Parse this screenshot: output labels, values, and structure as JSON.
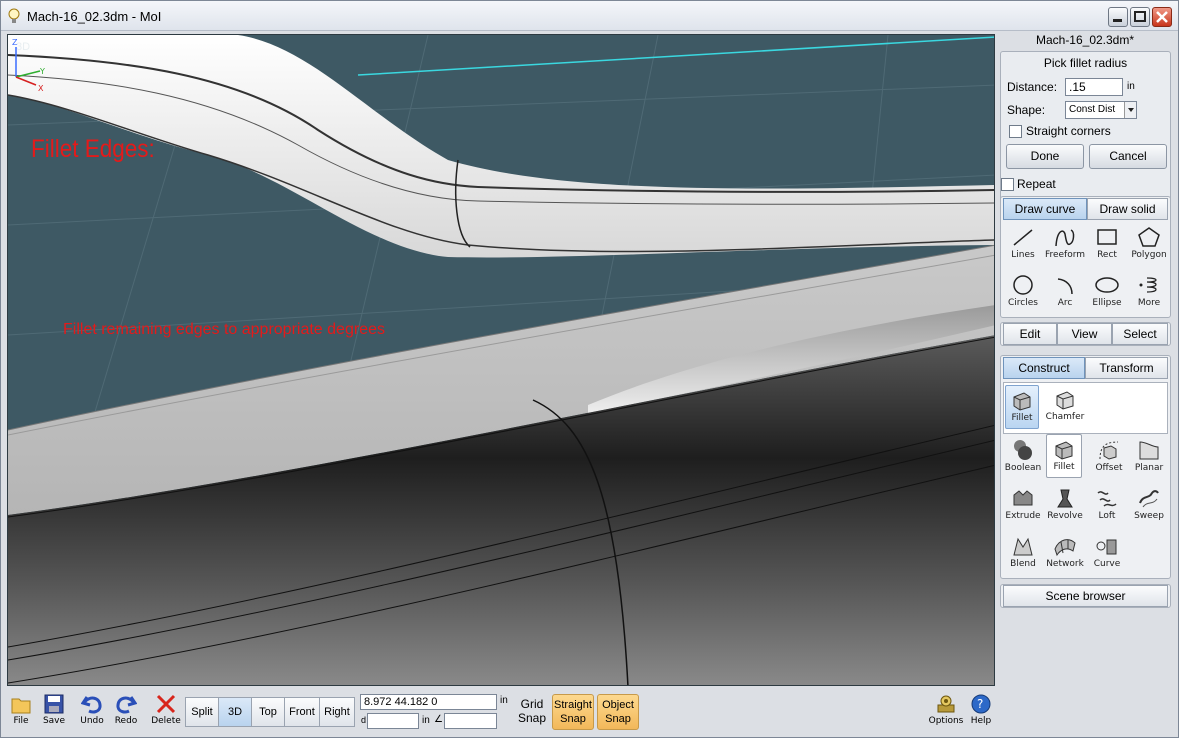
{
  "window": {
    "title": "Mach-16_02.3dm - MoI"
  },
  "viewport": {
    "label": "3D",
    "annotation_title": "Fillet Edges:",
    "annotation_text": "Fillet remaining edges to appropriate degrees",
    "axes": {
      "z": "Z",
      "y": "Y",
      "x": "X"
    }
  },
  "panel": {
    "file_name": "Mach-16_02.3dm*",
    "prompt": "Pick fillet radius",
    "distance_label": "Distance:",
    "distance_value": ".15",
    "distance_unit": "in",
    "shape_label": "Shape:",
    "shape_value": "Const Dist",
    "straight_corners": "Straight corners",
    "done": "Done",
    "cancel": "Cancel",
    "repeat": "Repeat",
    "draw_tabs": [
      "Draw curve",
      "Draw solid"
    ],
    "draw_tools": [
      "Lines",
      "Freeform",
      "Rect",
      "Polygon",
      "Circles",
      "Arc",
      "Ellipse",
      "More"
    ],
    "mid_tabs": [
      "Edit",
      "View",
      "Select"
    ],
    "construct_tabs": [
      "Construct",
      "Transform"
    ],
    "sub_tools": [
      "Fillet",
      "Chamfer"
    ],
    "construct_tools": [
      "Boolean",
      "Fillet",
      "Offset",
      "Planar",
      "Extrude",
      "Revolve",
      "Loft",
      "Sweep",
      "Blend",
      "Network",
      "Curve"
    ],
    "scene_browser": "Scene browser"
  },
  "bottom": {
    "file": "File",
    "save": "Save",
    "undo": "Undo",
    "redo": "Redo",
    "delete": "Delete",
    "views": [
      "Split",
      "3D",
      "Top",
      "Front",
      "Right"
    ],
    "coords": "8.972     44.182     0",
    "coord_unit": "in",
    "d_label": "d",
    "len_unit": "in",
    "angle": "∠",
    "grid_snap_1": "Grid",
    "grid_snap_2": "Snap",
    "straight_snap_1": "Straight",
    "straight_snap_2": "Snap",
    "object_snap_1": "Object",
    "object_snap_2": "Snap",
    "options": "Options",
    "help": "Help"
  }
}
